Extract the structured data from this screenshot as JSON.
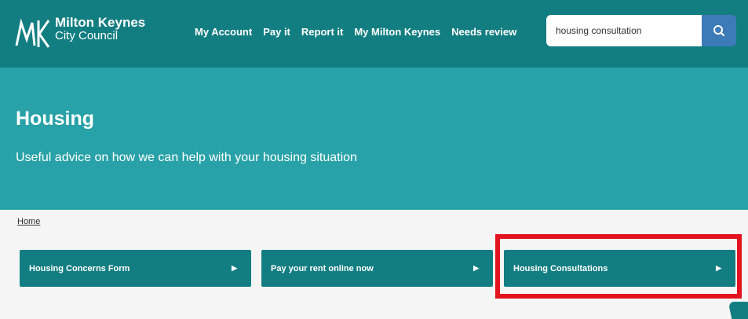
{
  "logo": {
    "name": "Milton Keynes",
    "sub": "City Council"
  },
  "nav": [
    "My Account",
    "Pay it",
    "Report it",
    "My Milton Keynes",
    "Needs review"
  ],
  "search": {
    "value": "housing consultation"
  },
  "hero": {
    "title": "Housing",
    "subtitle": "Useful advice on how we can help with your housing situation"
  },
  "breadcrumb": {
    "home": "Home"
  },
  "cards": [
    "Housing Concerns Form",
    "Pay your rent online now",
    "Housing Consultations"
  ],
  "colors": {
    "header": "#137e82",
    "hero": "#28a2a8",
    "search_button": "#3d7ab8",
    "highlight": "#e3141e"
  }
}
